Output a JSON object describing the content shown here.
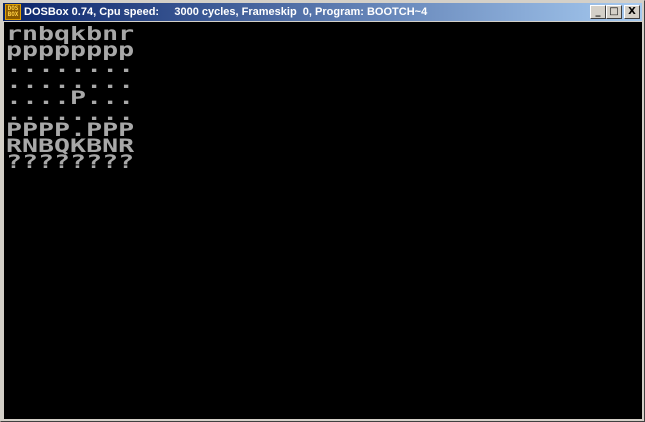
{
  "window": {
    "title": "DOSBox 0.74, Cpu speed:     3000 cycles, Frameskip  0, Program: BOOTCH~4",
    "icon_text": [
      "DOS",
      "BOX"
    ],
    "minimize": "_",
    "maximize": "□",
    "close": "X"
  },
  "board": {
    "rows": [
      "rnbqkbnr",
      "pppppppp",
      "........",
      "........",
      "....P...",
      "........",
      "PPPP.PPP",
      "RNBQKBNR",
      "????????"
    ]
  }
}
